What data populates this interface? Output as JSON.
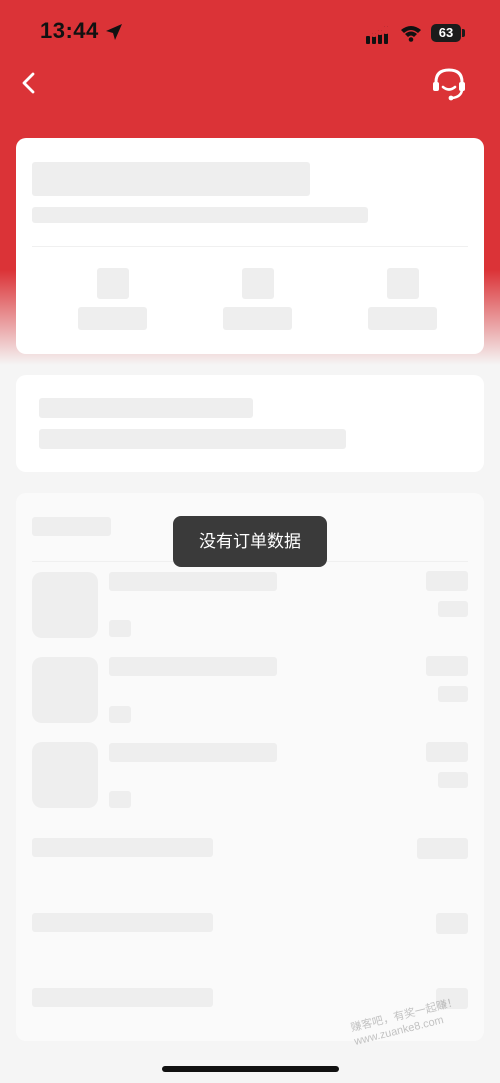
{
  "status_bar": {
    "time": "13:44",
    "battery": "63",
    "icons": [
      "location-arrow-icon",
      "cellular-signal-icon",
      "wifi-icon",
      "battery-icon"
    ]
  },
  "nav": {
    "back_icon": "chevron-left-icon",
    "support_icon": "headset-customer-service-icon",
    "accent_color": "#db3337"
  },
  "toast": {
    "message": "没有订单数据"
  },
  "watermark": {
    "text_line1": "赚客吧，有奖一起赚！",
    "text_line2": "www.zuanke8.com"
  },
  "colors": {
    "header_red": "#db3337",
    "page_background": "#f5f5f5",
    "skeleton": "#eeeeee",
    "toast_background": "#3a3a3a"
  }
}
